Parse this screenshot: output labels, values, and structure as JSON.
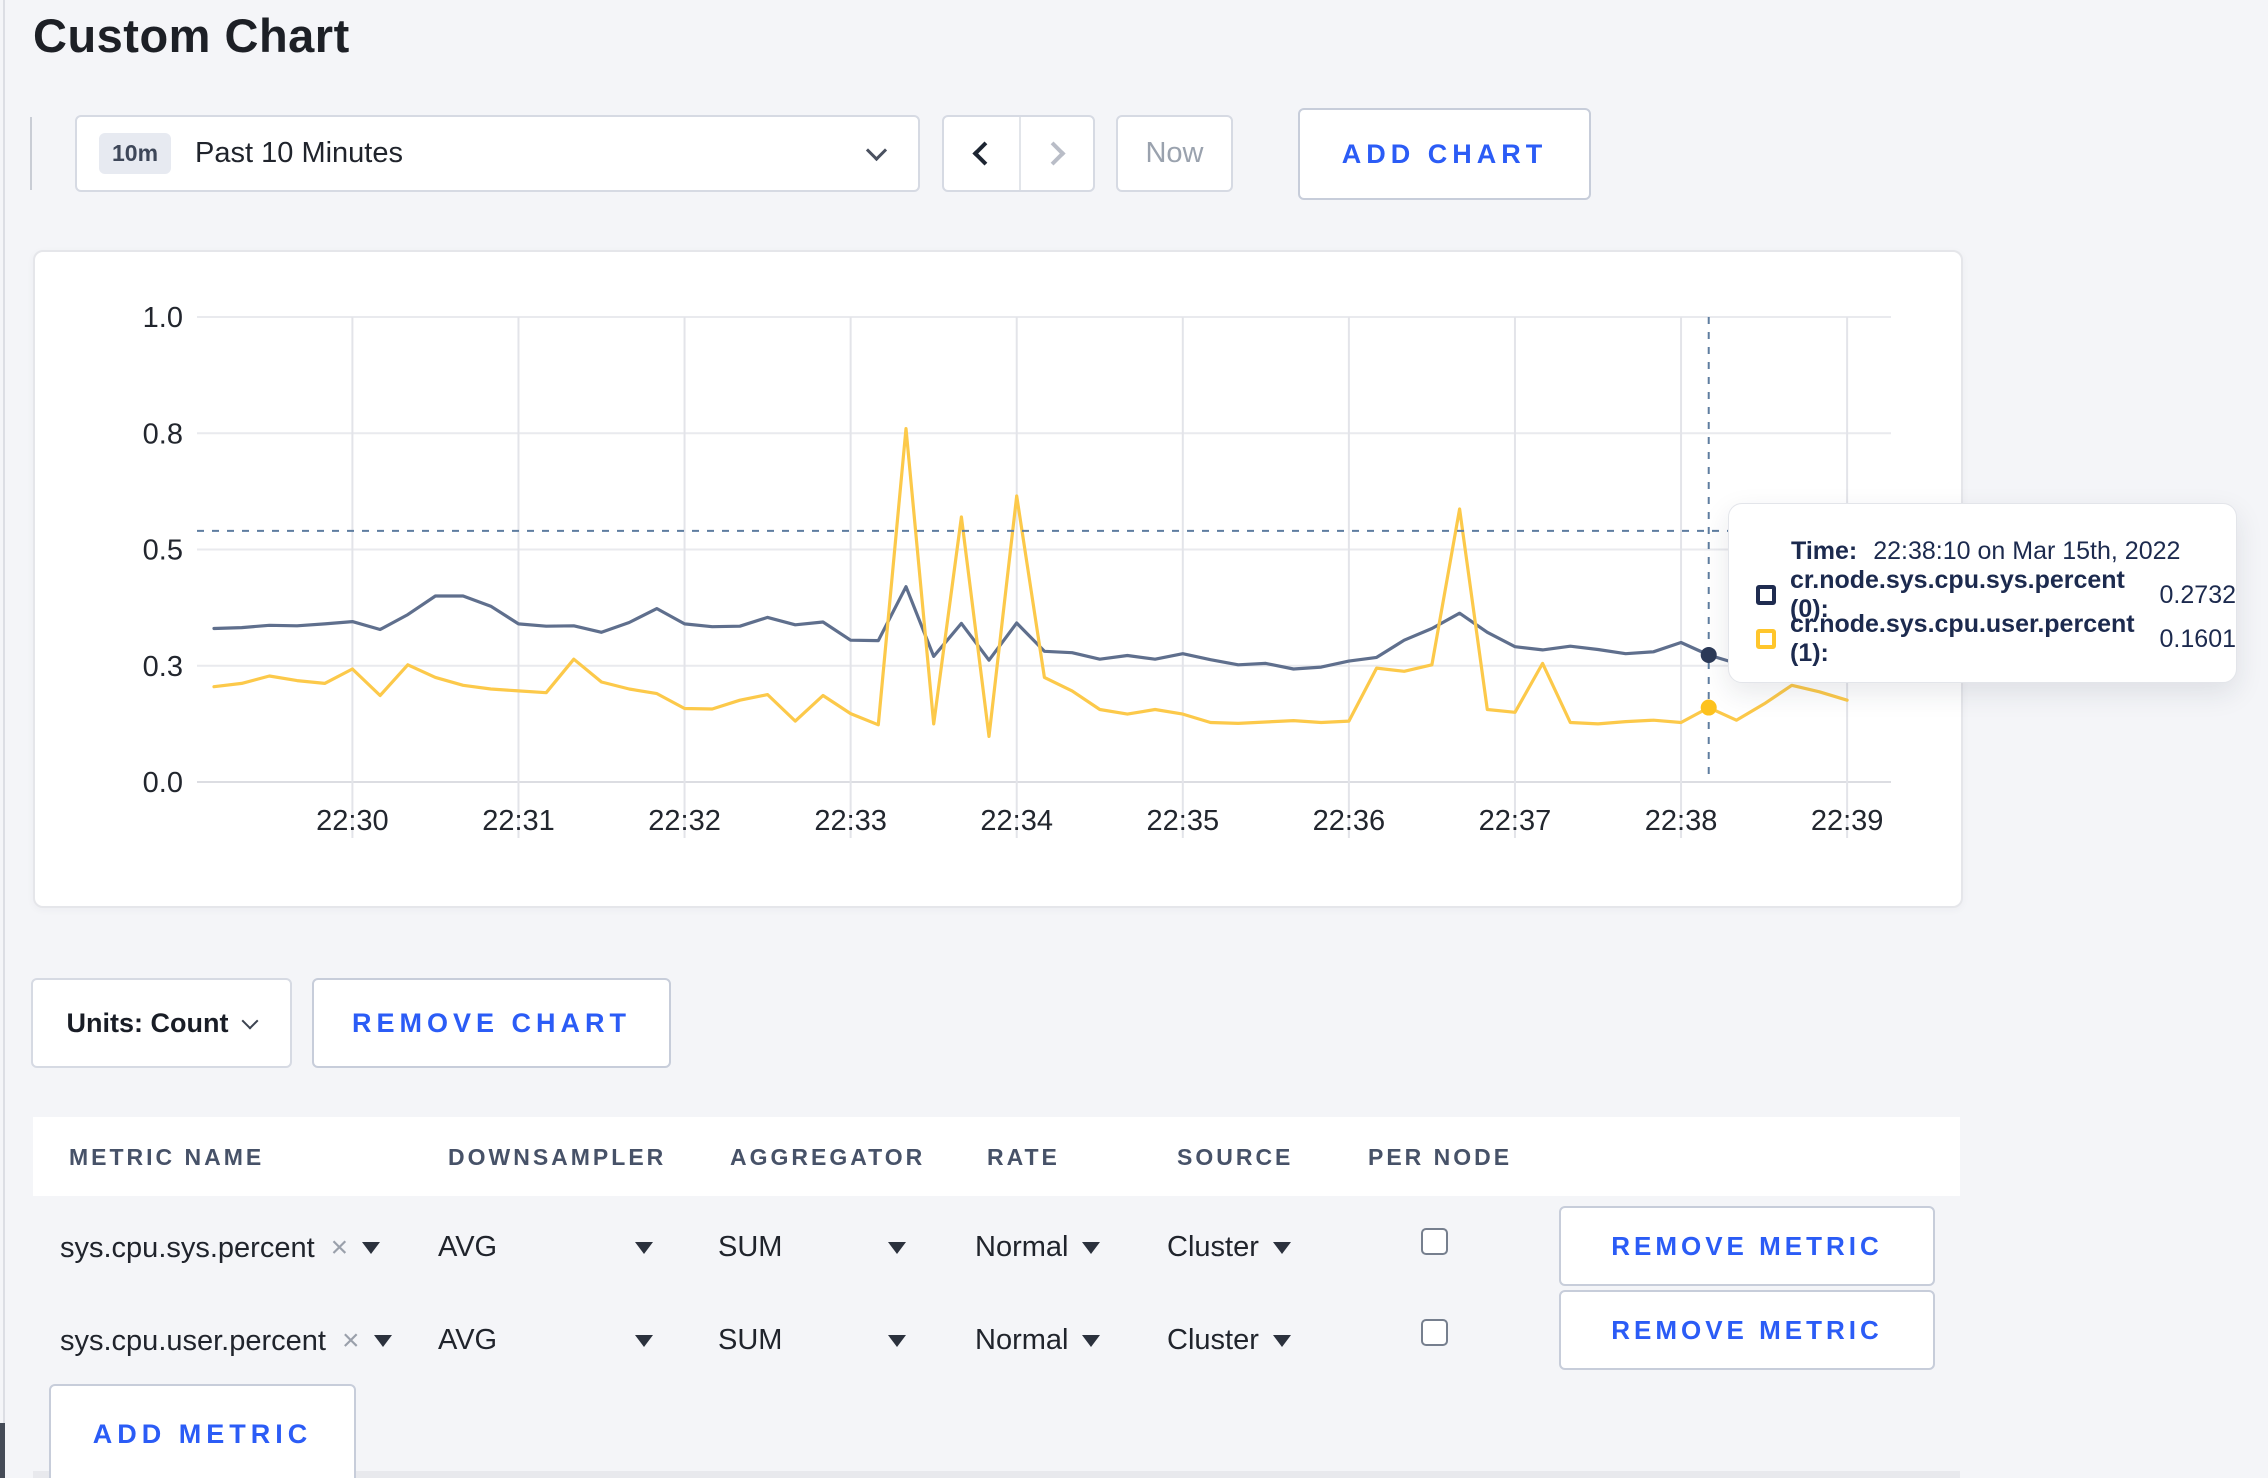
{
  "page": {
    "title": "Custom Chart"
  },
  "toolbar": {
    "range_badge": "10m",
    "range_label": "Past 10 Minutes",
    "now_label": "Now",
    "add_chart_label": "ADD CHART"
  },
  "chart_actions": {
    "units_label": "Units: Count",
    "remove_chart_label": "REMOVE CHART"
  },
  "tooltip": {
    "time_label": "Time:",
    "time_value": "22:38:10 on Mar 15th, 2022",
    "series": [
      {
        "name": "cr.node.sys.cpu.sys.percent (0):",
        "value": "0.2732",
        "color": "#1f2c50"
      },
      {
        "name": "cr.node.sys.cpu.user.percent (1):",
        "value": "0.1601",
        "color": "#ffc62c"
      }
    ]
  },
  "metrics_table": {
    "headers": [
      "METRIC NAME",
      "DOWNSAMPLER",
      "AGGREGATOR",
      "RATE",
      "SOURCE",
      "PER NODE"
    ],
    "rows": [
      {
        "metric": "sys.cpu.sys.percent",
        "downsampler": "AVG",
        "aggregator": "SUM",
        "rate": "Normal",
        "source": "Cluster",
        "per_node_checked": false,
        "remove_label": "REMOVE METRIC"
      },
      {
        "metric": "sys.cpu.user.percent",
        "downsampler": "AVG",
        "aggregator": "SUM",
        "rate": "Normal",
        "source": "Cluster",
        "per_node_checked": false,
        "remove_label": "REMOVE METRIC"
      }
    ],
    "add_metric_label": "ADD METRIC"
  },
  "chart_data": {
    "type": "line",
    "title": "",
    "x_start": "22:29:10",
    "x_step_seconds": 10,
    "xtick_labels": [
      "22:30",
      "22:31",
      "22:32",
      "22:33",
      "22:34",
      "22:35",
      "22:36",
      "22:37",
      "22:38",
      "22:39"
    ],
    "ytick_values": [
      0,
      0.25,
      0.5,
      0.75,
      1.0
    ],
    "ytick_labels": [
      "0.0",
      "0.3",
      "0.5",
      "0.8",
      "1.0"
    ],
    "ylim": [
      0,
      1
    ],
    "grid": true,
    "legend_position": "tooltip-only",
    "series": [
      {
        "name": "cr.node.sys.cpu.sys.percent",
        "color": "#5f6f8d",
        "dot_color": "#2c3a58",
        "values": [
          0.33,
          0.332,
          0.337,
          0.336,
          0.34,
          0.345,
          0.328,
          0.36,
          0.4,
          0.4,
          0.378,
          0.34,
          0.335,
          0.336,
          0.322,
          0.343,
          0.373,
          0.34,
          0.334,
          0.335,
          0.354,
          0.338,
          0.344,
          0.305,
          0.304,
          0.42,
          0.27,
          0.341,
          0.262,
          0.342,
          0.281,
          0.278,
          0.264,
          0.272,
          0.264,
          0.276,
          0.263,
          0.252,
          0.255,
          0.243,
          0.247,
          0.26,
          0.268,
          0.305,
          0.33,
          0.363,
          0.322,
          0.291,
          0.284,
          0.292,
          0.285,
          0.276,
          0.28,
          0.3,
          0.2732,
          0.255,
          0.281,
          0.292,
          0.284,
          0.288
        ]
      },
      {
        "name": "cr.node.sys.cpu.user.percent",
        "color": "#fcc94a",
        "dot_color": "#fdc21d",
        "values": [
          0.205,
          0.212,
          0.228,
          0.218,
          0.212,
          0.243,
          0.186,
          0.252,
          0.225,
          0.208,
          0.2,
          0.196,
          0.192,
          0.264,
          0.215,
          0.2,
          0.19,
          0.158,
          0.157,
          0.176,
          0.188,
          0.131,
          0.186,
          0.147,
          0.123,
          0.76,
          0.125,
          0.57,
          0.098,
          0.615,
          0.225,
          0.196,
          0.156,
          0.146,
          0.156,
          0.146,
          0.128,
          0.126,
          0.129,
          0.132,
          0.128,
          0.131,
          0.245,
          0.238,
          0.252,
          0.587,
          0.156,
          0.15,
          0.255,
          0.128,
          0.125,
          0.13,
          0.133,
          0.128,
          0.1601,
          0.133,
          0.168,
          0.208,
          0.194,
          0.176
        ]
      }
    ],
    "crosshair": {
      "index": 54,
      "time": "22:38:10",
      "hline_value": 0.54,
      "color": "#5e7da0"
    }
  }
}
